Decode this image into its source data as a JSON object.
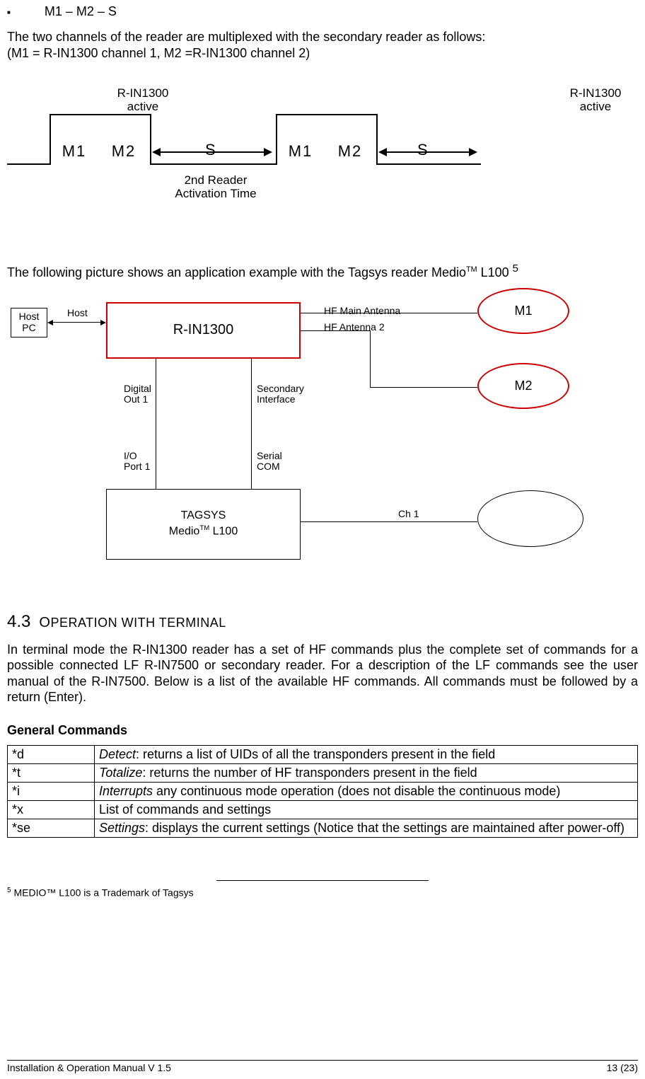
{
  "bullet": "M1 – M2 – S",
  "intro_line1": "The  two channels of  the reader are multiplexed with the secondary reader as follows:",
  "intro_line2": "(M1 = R-IN1300 channel 1, M2 =R-IN1300  channel 2)",
  "timing": {
    "caption_active_1a": "R-IN1300",
    "caption_active_1b": "active",
    "caption_active_2a": "R-IN1300",
    "caption_active_2b": "active",
    "m1": "M1",
    "m2": "M2",
    "s": "S",
    "bottom_1": "2nd Reader",
    "bottom_2": "Activation Time"
  },
  "example_line_pre": "The following picture shows an application example with the Tagsys reader Medio",
  "example_line_tm": "TM",
  "example_line_post": " L100 ",
  "example_line_fn": "5",
  "diagram": {
    "host_pc": "Host\nPC",
    "host_label": "Host",
    "rin": "R-IN1300",
    "hf_main": "HF Main Antenna",
    "hf2": "HF Antenna 2",
    "m1": "M1",
    "m2": "M2",
    "digital_out": "Digital\nOut 1",
    "secondary_if": "Secondary\nInterface",
    "io_port": "I/O\nPort 1",
    "serial_com": "Serial\nCOM",
    "tagsys_1": "TAGSYS",
    "tagsys_2_pre": "Medio",
    "tagsys_2_tm": "TM",
    "tagsys_2_post": " L100",
    "ch1": "Ch 1"
  },
  "section": {
    "num": "4.3",
    "first": "O",
    "rest": "PERATION WITH TERMINAL"
  },
  "section_para": "In terminal mode the R-IN1300 reader has a set of HF commands plus the complete set of commands for a possible connected LF R-IN7500 or secondary reader. For a description of the LF commands see the user manual of the R-IN7500. Below is a list of the available HF commands. All commands must be followed by a return (Enter).",
  "general_commands_heading": "General Commands",
  "commands": [
    {
      "cmd": "*d",
      "desc_i": "Detect",
      "desc_r": ": returns a list of UIDs of all the transponders present in the field"
    },
    {
      "cmd": "*t",
      "desc_i": "Totalize",
      "desc_r": ": returns the number of HF transponders present in the field"
    },
    {
      "cmd": "*i",
      "desc_i": "Interrupts",
      "desc_r": " any continuous mode operation (does not disable the continuous mode)"
    },
    {
      "cmd": "*x",
      "desc_i": "",
      "desc_r": "List of commands and settings"
    },
    {
      "cmd": "*se",
      "desc_i": "Settings",
      "desc_r": ": displays the current settings (Notice that the settings are maintained after power-off)"
    }
  ],
  "footnote": "MEDIO™ L100 is a Trademark  of Tagsys",
  "footer_left": "Installation & Operation Manual V 1.5",
  "footer_right": "13 (23)"
}
